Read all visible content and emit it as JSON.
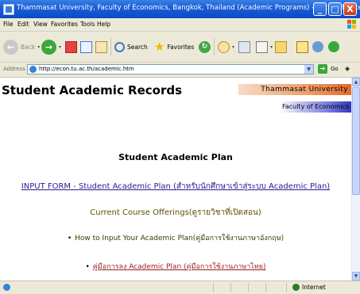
{
  "window": {
    "title": "Thammasat University, Faculty of Economics, Bangkok, Thailand (Academic Programs) - Microsoft Inter...",
    "controls": {
      "minimize": "_",
      "maximize": "□",
      "close": "X"
    }
  },
  "menu": [
    "File",
    "Edit",
    "View",
    "Favorites",
    "Tools",
    "Help"
  ],
  "toolbar": {
    "back_label": "Back",
    "search_label": "Search",
    "favorites_label": "Favorites"
  },
  "address_bar": {
    "label": "Address",
    "url": "http://econ.tu.ac.th/academic.htm",
    "go_label": "Go"
  },
  "page": {
    "title": "Student Academic Records",
    "banner_university": "Thammasat University",
    "banner_faculty": "Faculty of Economics",
    "section_heading": "Student Academic Plan",
    "input_form_link": "INPUT FORM - Student Academic Plan (สำหรับนักศึกษาเข้าสู่ระบบ Academic Plan)",
    "current_offerings": "Current Course Offerings(ดูรายวิชาที่เปิดสอน)",
    "how_to_input": "How to Input Your Academic Plan(คู่มือการใช้งานภาษาอังกฤษ)",
    "manual_thai": "คู่มือการลง Academic Plan (คู่มือการใช้งานภาษาไทย)"
  },
  "status_bar": {
    "zone": "Internet"
  },
  "colors": {
    "titlebar": "#1c5fd6",
    "chrome": "#ece9d8",
    "link_blue": "#2a1a8f",
    "olive_text": "#5a5000",
    "banner_orange": "#e66a2c",
    "banner_blue": "#2f37b8"
  }
}
